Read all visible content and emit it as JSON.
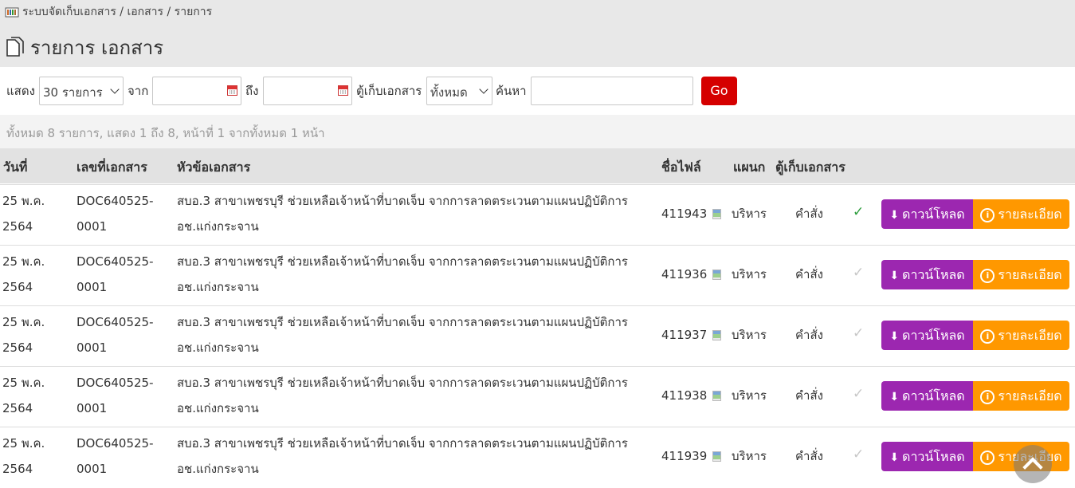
{
  "breadcrumb": {
    "icon": "archive-icon",
    "text": "ระบบจัดเก็บเอกสาร / เอกสาร / รายการ"
  },
  "page_title": "รายการ เอกสาร",
  "filters": {
    "show_label": "แสดง",
    "show_value": "30 รายการ",
    "from_label": "จาก",
    "from_value": "",
    "to_label": "ถึง",
    "to_value": "",
    "cabinet_label": "ตู้เก็บเอกสาร",
    "cabinet_value": "ทั้งหมด",
    "search_label": "ค้นหา",
    "search_value": "",
    "go_label": "Go"
  },
  "summary": "ทั้งหมด 8 รายการ, แสดง 1 ถึง 8, หน้าที่ 1 จากทั้งหมด 1 หน้า",
  "columns": [
    "วันที่",
    "เลขที่เอกสาร",
    "หัวข้อเอกสาร",
    "ชื่อไฟล์",
    "แผนก",
    "ตู้เก็บเอกสาร"
  ],
  "rows": [
    {
      "date_1": "25 พ.ค.",
      "date_2": "2564",
      "doc_1": "DOC640525-",
      "doc_2": "0001",
      "title_1": "สบอ.3 สาขาเพชรบุรี ช่วยเหลือเจ้าหน้าที่บาดเจ็บ จากการลาดตระเวนตามแผนปฏิบัติการ",
      "title_2": "อช.แก่งกระจาน",
      "file": "411943",
      "dept": "บริหาร",
      "cabinet": "คำสั่ง",
      "check": "✓",
      "download": "ดาวน์โหลด",
      "detail": "รายละเอียด"
    },
    {
      "date_1": "25 พ.ค.",
      "date_2": "2564",
      "doc_1": "DOC640525-",
      "doc_2": "0001",
      "title_1": "สบอ.3 สาขาเพชรบุรี ช่วยเหลือเจ้าหน้าที่บาดเจ็บ จากการลาดตระเวนตามแผนปฏิบัติการ",
      "title_2": "อช.แก่งกระจาน",
      "file": "411936",
      "dept": "บริหาร",
      "cabinet": "คำสั่ง",
      "check": "✓",
      "download": "ดาวน์โหลด",
      "detail": "รายละเอียด"
    },
    {
      "date_1": "25 พ.ค.",
      "date_2": "2564",
      "doc_1": "DOC640525-",
      "doc_2": "0001",
      "title_1": "สบอ.3 สาขาเพชรบุรี ช่วยเหลือเจ้าหน้าที่บาดเจ็บ จากการลาดตระเวนตามแผนปฏิบัติการ",
      "title_2": "อช.แก่งกระจาน",
      "file": "411937",
      "dept": "บริหาร",
      "cabinet": "คำสั่ง",
      "check": "✓",
      "download": "ดาวน์โหลด",
      "detail": "รายละเอียด"
    },
    {
      "date_1": "25 พ.ค.",
      "date_2": "2564",
      "doc_1": "DOC640525-",
      "doc_2": "0001",
      "title_1": "สบอ.3 สาขาเพชรบุรี ช่วยเหลือเจ้าหน้าที่บาดเจ็บ จากการลาดตระเวนตามแผนปฏิบัติการ",
      "title_2": "อช.แก่งกระจาน",
      "file": "411938",
      "dept": "บริหาร",
      "cabinet": "คำสั่ง",
      "check": "✓",
      "download": "ดาวน์โหลด",
      "detail": "รายละเอียด"
    },
    {
      "date_1": "25 พ.ค.",
      "date_2": "2564",
      "doc_1": "DOC640525-",
      "doc_2": "0001",
      "title_1": "สบอ.3 สาขาเพชรบุรี ช่วยเหลือเจ้าหน้าที่บาดเจ็บ จากการลาดตระเวนตามแผนปฏิบัติการ",
      "title_2": "อช.แก่งกระจาน",
      "file": "411939",
      "dept": "บริหาร",
      "cabinet": "คำสั่ง",
      "check": "✓",
      "download": "ดาวน์โหลด",
      "detail": "รายละเอียด"
    }
  ],
  "row_check_colors": [
    "#2e9e3e",
    "#c8c8c8",
    "#c8c8c8",
    "#c8c8c8",
    "#c8c8c8"
  ],
  "colors": {
    "go": "#d50000",
    "download": "#9c27b0",
    "detail": "#ff9800"
  }
}
